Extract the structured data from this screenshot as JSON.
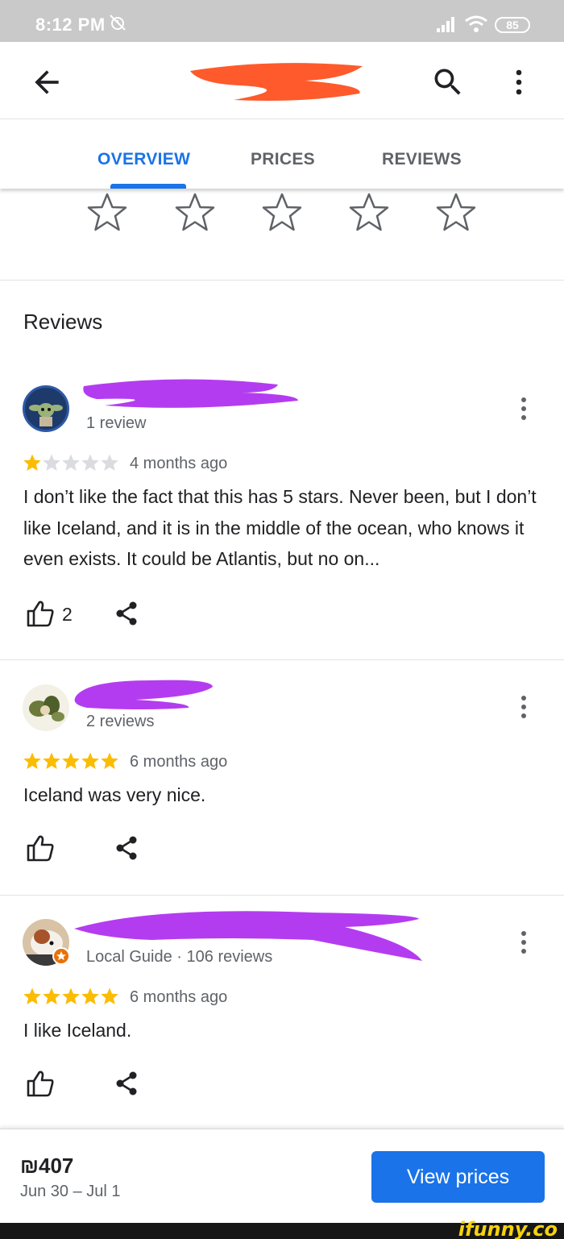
{
  "status_bar": {
    "time": "8:12 PM",
    "battery": "85"
  },
  "app_bar": {
    "icons": [
      "back-arrow-icon",
      "search-icon",
      "more-vert-icon"
    ]
  },
  "tabs": [
    {
      "label": "OVERVIEW",
      "active": true
    },
    {
      "label": "PRICES",
      "active": false
    },
    {
      "label": "REVIEWS",
      "active": false
    }
  ],
  "rating_prompt": {
    "star_count": 5,
    "selected": 0
  },
  "reviews_section": {
    "heading": "Reviews"
  },
  "reviews": [
    {
      "reviewer_meta": "1 review",
      "rating": 1,
      "date": "4 months ago",
      "text": "I don’t like the fact that this has 5 stars. Never been, but I don’t like Iceland, and it is in the middle of the ocean, who knows it even exists. It could be Atlantis, but no on...",
      "likes": "2"
    },
    {
      "reviewer_meta": "2 reviews",
      "rating": 5,
      "date": "6 months ago",
      "text": "Iceland was very nice.",
      "likes": ""
    },
    {
      "reviewer_meta": "Local Guide · 106 reviews",
      "rating": 5,
      "date": "6 months ago",
      "text": "I like Iceland.",
      "likes": ""
    }
  ],
  "footer": {
    "price": "₪407",
    "dates": "Jun 30 – Jul 1",
    "button_label": "View prices"
  },
  "watermark": "ifunny.co",
  "colors": {
    "accent": "#1a73e8",
    "star_filled": "#fbbc04",
    "star_empty": "#dadce0",
    "redact_orange": "#ff5a2b",
    "redact_purple": "#b43cf0"
  }
}
